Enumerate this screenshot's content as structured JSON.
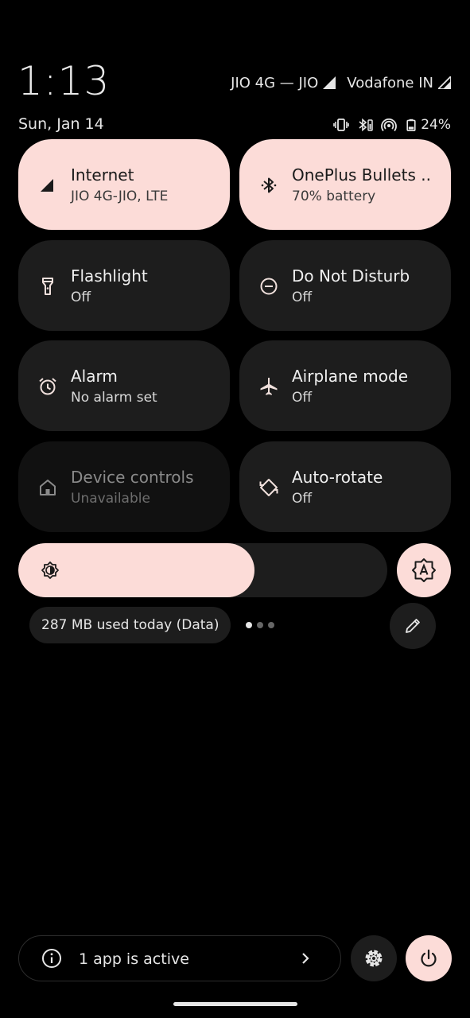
{
  "status": {
    "time": "1:13",
    "date": "Sun, Jan 14",
    "carrier1": "JIO 4G — JIO",
    "carrier2": "Vodafone IN",
    "battery": "24%",
    "icons": [
      "vibrate-icon",
      "bluetooth-battery-icon",
      "hotspot-icon",
      "battery-icon"
    ]
  },
  "tiles": [
    {
      "title": "Internet",
      "subtitle": "JIO 4G-JIO, LTE",
      "icon": "signal-icon",
      "state": "active"
    },
    {
      "title": "OnePlus Bullets ..",
      "subtitle": "70% battery",
      "icon": "bluetooth-icon",
      "state": "active"
    },
    {
      "title": "Flashlight",
      "subtitle": "Off",
      "icon": "flashlight-icon",
      "state": "off"
    },
    {
      "title": "Do Not Disturb",
      "subtitle": "Off",
      "icon": "dnd-icon",
      "state": "off"
    },
    {
      "title": "Alarm",
      "subtitle": "No alarm set",
      "icon": "alarm-icon",
      "state": "off"
    },
    {
      "title": "Airplane mode",
      "subtitle": "Off",
      "icon": "airplane-icon",
      "state": "off"
    },
    {
      "title": "Device controls",
      "subtitle": "Unavailable",
      "icon": "home-icon",
      "state": "disabled"
    },
    {
      "title": "Auto-rotate",
      "subtitle": "Off",
      "icon": "rotate-icon",
      "state": "off"
    }
  ],
  "brightness": {
    "level": 0.64,
    "icon": "brightness-icon",
    "auto_icon": "auto-brightness-icon"
  },
  "data_usage": "287 MB used today (Data)",
  "pager": {
    "pages": 3,
    "current": 0
  },
  "footer": {
    "active_apps": "1 app is active"
  },
  "colors": {
    "accent": "#fcdcd8",
    "tile_bg": "#1d1d1d",
    "background": "#000000"
  }
}
